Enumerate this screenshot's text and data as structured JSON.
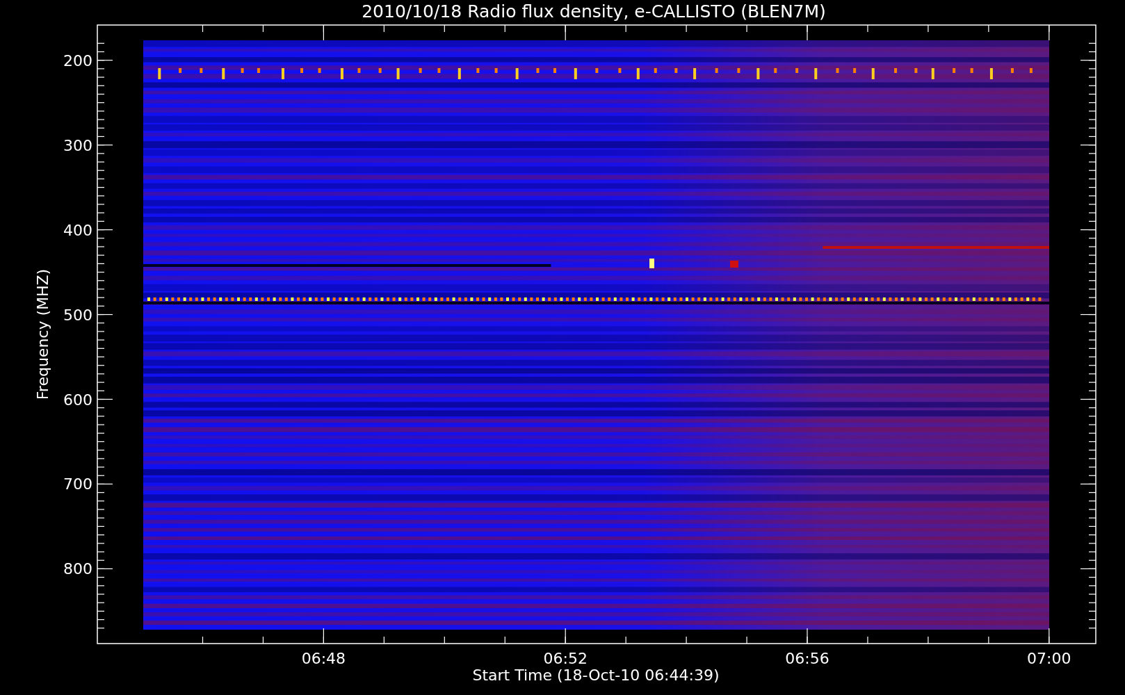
{
  "chart": {
    "title": "2010/10/18  Radio flux density, e-CALLISTO (BLEN7M)",
    "xlabel": "Start Time (18-Oct-10 06:44:39)",
    "ylabel": "Frequency (MHZ)",
    "yticks": [
      "200",
      "300",
      "400",
      "500",
      "600",
      "700",
      "800"
    ],
    "xticks": [
      "06:48",
      "06:52",
      "06:56",
      "07:00"
    ]
  }
}
